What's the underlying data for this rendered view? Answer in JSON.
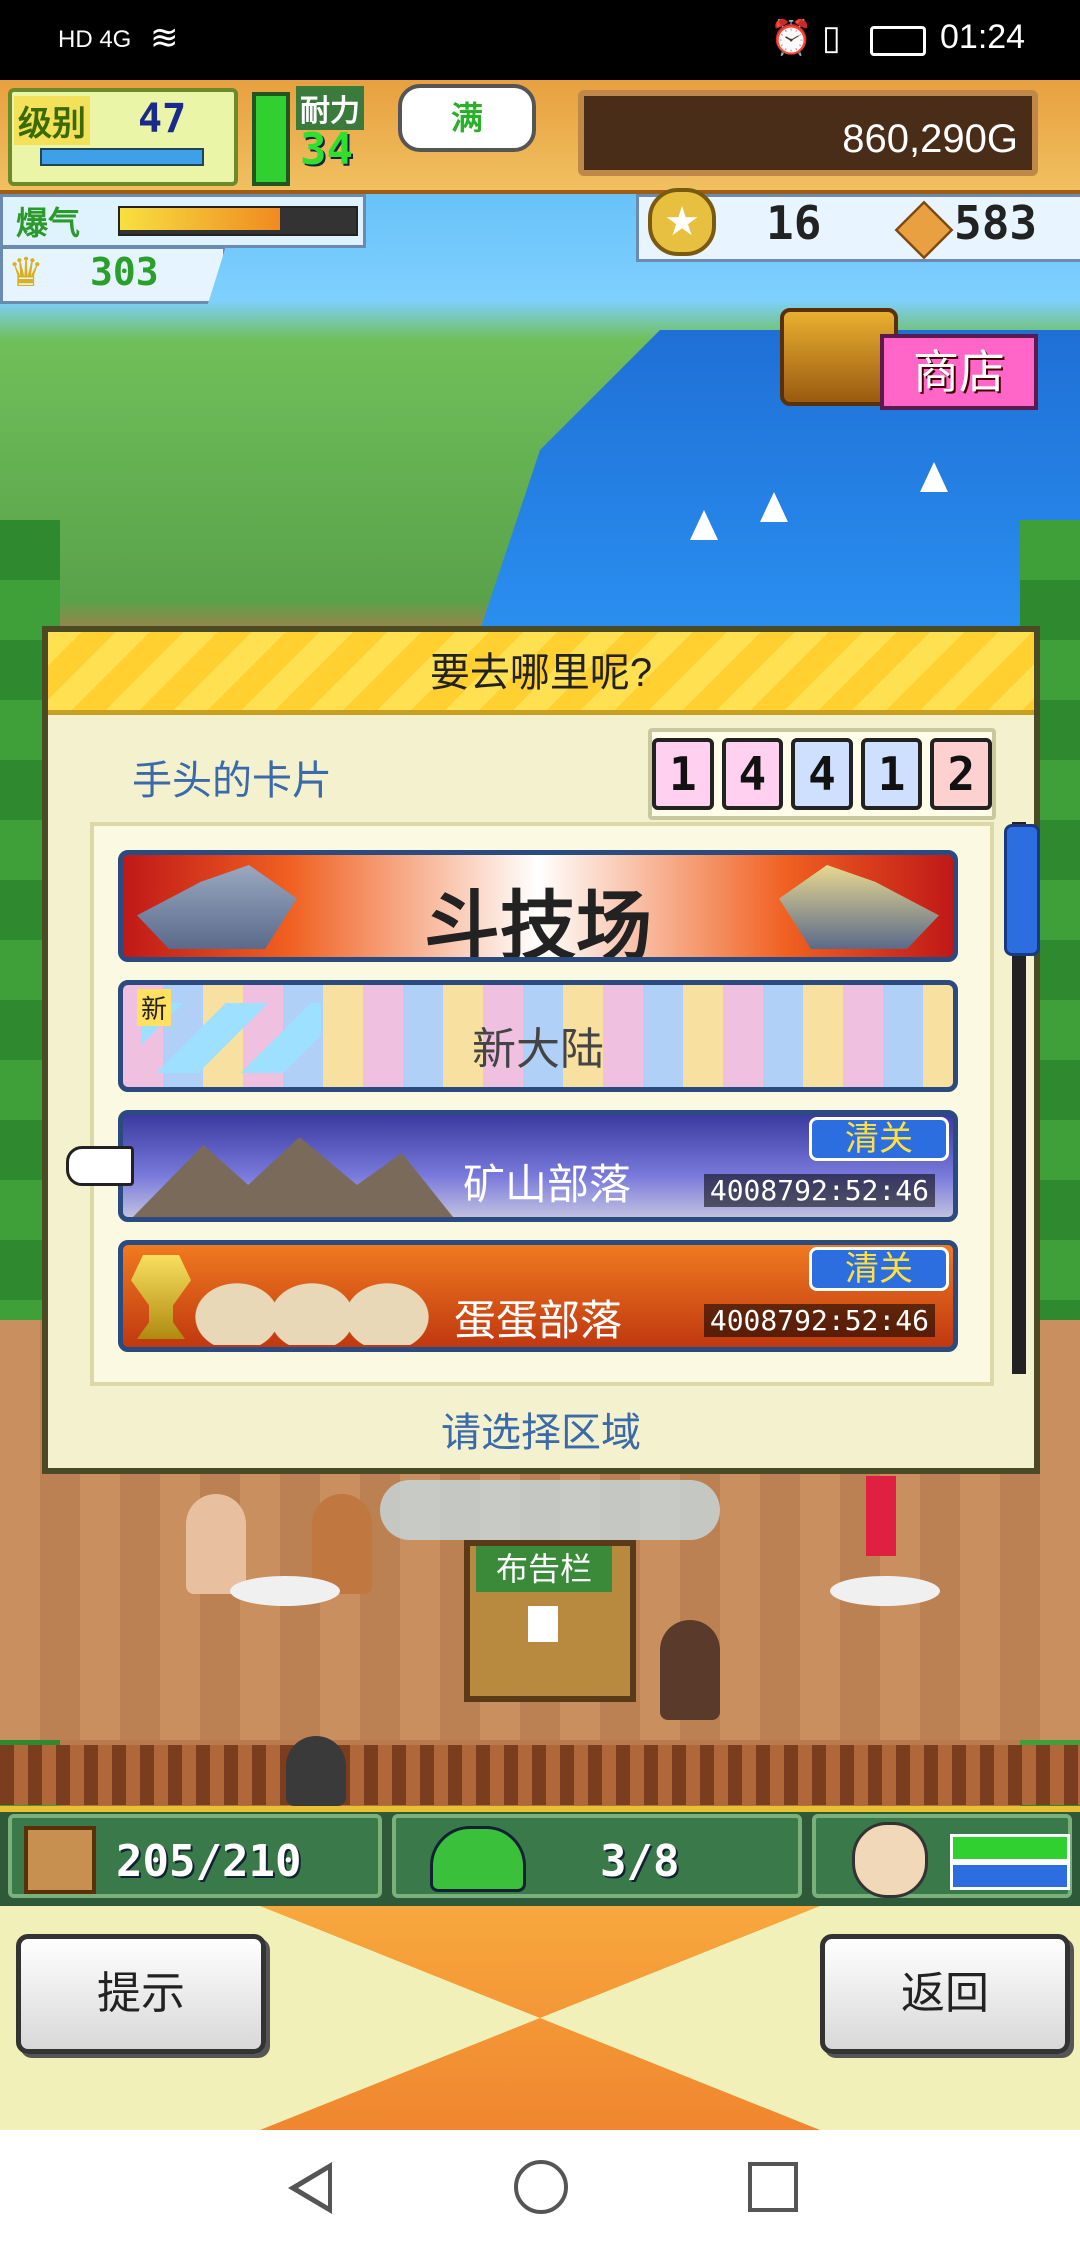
{
  "status_bar": {
    "network": "HD 4G",
    "time": "01:24"
  },
  "hud_top": {
    "level_label": "级别",
    "level_value": "47",
    "stamina_label": "耐力",
    "stamina_value": "34",
    "stamina_bubble": "满",
    "money": "860,290G",
    "fever_label": "爆气",
    "fever_level": 0.68,
    "trophy_count": "303",
    "medal_count": "16",
    "box_count": "583"
  },
  "shop": {
    "label": "商店"
  },
  "dialog": {
    "title": "要去哪里呢?",
    "cards_label": "手头的卡片",
    "card_values": [
      "1",
      "4",
      "4",
      "1",
      "2"
    ],
    "card_colors": [
      "#ffd0f0",
      "#ffd0f0",
      "#cfe0ff",
      "#cfe0ff",
      "#ffd0d0"
    ],
    "areas": [
      {
        "name": "斗技场",
        "cleared": "",
        "time": ""
      },
      {
        "name": "新大陆",
        "badge": "新",
        "cleared": "",
        "time": ""
      },
      {
        "name": "矿山部落",
        "cleared": "清关",
        "time": "4008792:52:46"
      },
      {
        "name": "蛋蛋部落",
        "cleared": "清关",
        "time": "4008792:52:46"
      }
    ],
    "hint": "请选择区域"
  },
  "scene": {
    "bulletin_label": "布告栏"
  },
  "hud_bottom": {
    "warehouse": "205/210",
    "staff": "3/8"
  },
  "buttons": {
    "hint": "提示",
    "back": "返回"
  }
}
